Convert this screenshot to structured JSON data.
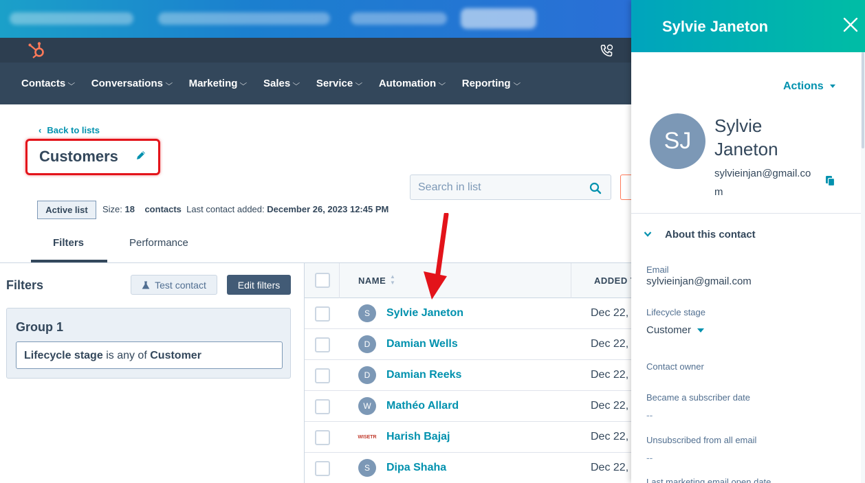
{
  "nav": {
    "items": [
      {
        "label": "Contacts"
      },
      {
        "label": "Conversations"
      },
      {
        "label": "Marketing"
      },
      {
        "label": "Sales"
      },
      {
        "label": "Service"
      },
      {
        "label": "Automation"
      },
      {
        "label": "Reporting"
      }
    ],
    "chevron": "⌵"
  },
  "list": {
    "back_label": "Back to lists",
    "back_glyph": "‹",
    "title": "Customers",
    "search_placeholder": "Search in list",
    "active_tag": "Active list",
    "size_label": "Size:",
    "size_value": "18",
    "size_unit": "contacts",
    "last_added_label": "Last contact added:",
    "last_added_value": "December 26, 2023 12:45 PM"
  },
  "tabs": [
    {
      "label": "Filters",
      "active": true
    },
    {
      "label": "Performance",
      "active": false
    }
  ],
  "filters": {
    "title": "Filters",
    "test_button": "Test contact",
    "edit_button": "Edit filters",
    "group_title": "Group 1",
    "condition_property": "Lifecycle stage",
    "condition_operator": "is any of",
    "condition_value": "Customer"
  },
  "table": {
    "headers": {
      "name": "NAME",
      "added": "ADDED T"
    },
    "rows": [
      {
        "avatar": "S",
        "name": "Sylvie Janeton",
        "date": "Dec 22,"
      },
      {
        "avatar": "D",
        "name": "Damian Wells",
        "date": "Dec 22,"
      },
      {
        "avatar": "D",
        "name": "Damian Reeks",
        "date": "Dec 22,"
      },
      {
        "avatar": "W",
        "name": "Mathéo Allard",
        "date": "Dec 22,"
      },
      {
        "avatar": "WISETR",
        "name": "Harish Bajaj",
        "date": "Dec 22,"
      },
      {
        "avatar": "S",
        "name": "Dipa Shaha",
        "date": "Dec 22,"
      }
    ]
  },
  "panel": {
    "title": "Sylvie Janeton",
    "actions_label": "Actions",
    "initials": "SJ",
    "full_name": "Sylvie Janeton",
    "email": "sylvieinjan@gmail.com",
    "about_label": "About this contact",
    "props": {
      "email_label": "Email",
      "email_value": "sylvieinjan@gmail.com",
      "lifecycle_label": "Lifecycle stage",
      "lifecycle_value": "Customer",
      "owner_label": "Contact owner",
      "subscriber_label": "Became a subscriber date",
      "subscriber_value": "--",
      "unsub_label": "Unsubscribed from all email",
      "unsub_value": "--",
      "last_open_label": "Last marketing email open date"
    }
  },
  "colors": {
    "accent": "#0091ae",
    "nav_bg": "#33475b",
    "highlight": "#e3131a",
    "panel_header": "#00a4bd"
  }
}
